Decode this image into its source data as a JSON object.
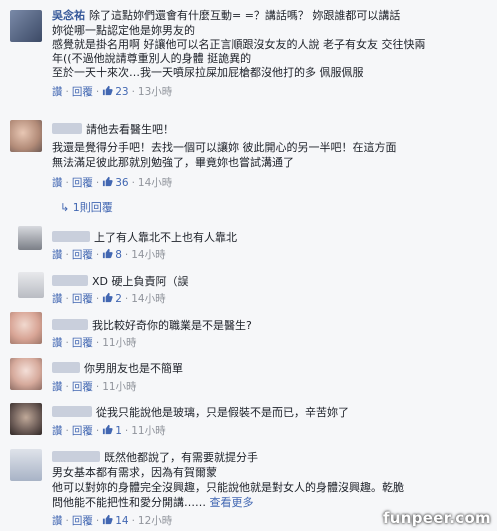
{
  "comments": [
    {
      "author": "吳念祐",
      "lines": [
        "除了這點妳們還會有什麼互動= =？講話嗎？ 妳跟誰都可以講話",
        "妳從哪一點認定他是妳男友的",
        "感覺就是掛名用啊 好讓他可以名正言順跟沒女友的人說 老子有女友 交往快兩",
        "年((不過他說請尊重別人的身體 挺詭異的",
        "至於一天十來次…我一天噴尿拉屎加屁槍都沒他打的多 佩服佩服"
      ],
      "reply": "讚",
      "respond": "回覆",
      "likes": "23",
      "time": "13小時"
    },
    {
      "author": "",
      "lines": [
        "請他去看醫生吧！",
        "我還是覺得分手吧！去找一個可以讓妳 彼此開心的另一半吧！在這方面",
        "無法滿足彼此那就別勉強了，畢竟妳也嘗試溝通了"
      ],
      "reply": "讚",
      "respond": "回覆",
      "likes": "36",
      "time": "14小時"
    },
    {
      "author": "",
      "lines": [
        "上了有人靠北不上也有人靠北"
      ],
      "reply": "讚",
      "respond": "回覆",
      "likes": "8",
      "time": "14小時"
    },
    {
      "author": "",
      "lines": [
        "XD 硬上負責阿（誤"
      ],
      "reply": "讚",
      "respond": "回覆",
      "likes": "2",
      "time": "14小時"
    },
    {
      "author": "",
      "lines": [
        "我比較好奇你的職業是不是醫生?"
      ],
      "reply": "讚",
      "respond": "回覆",
      "likes": "",
      "time": "11小時"
    },
    {
      "author": "",
      "lines": [
        "你男朋友也是不簡單"
      ],
      "reply": "讚",
      "respond": "回覆",
      "likes": "",
      "time": "11小時"
    },
    {
      "author": "",
      "lines": [
        "從我只能說他是玻璃，只是假裝不是而已，辛苦妳了"
      ],
      "reply": "讚",
      "respond": "回覆",
      "likes": "1",
      "time": "11小時"
    },
    {
      "author": "",
      "lines": [
        "既然他都說了，有需要就提分手",
        "男女基本都有需求，因為有賀爾蒙",
        "他可以對妳的身體完全沒興趣，只能說他就是對女人的身體沒興趣。乾脆",
        "問他能不能把性和愛分開講……"
      ],
      "more": "查看更多",
      "reply": "讚",
      "respond": "回覆",
      "likes": "14",
      "time": "12小時"
    }
  ],
  "replies_link": "1則回覆",
  "watermark": "funpeer.com"
}
